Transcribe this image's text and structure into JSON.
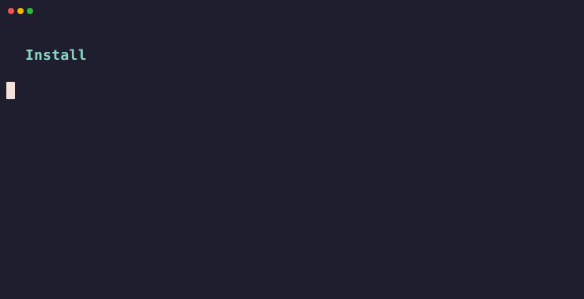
{
  "window": {
    "controls": {
      "close_color": "#f05454",
      "minimize_color": "#f5b700",
      "maximize_color": "#2ebd3b"
    }
  },
  "terminal": {
    "heading": "Install",
    "heading_color": "#8bd5c2",
    "background_color": "#1e1e2e",
    "cursor_color": "#f5e0dc",
    "cursor_icon": "block-cursor"
  }
}
